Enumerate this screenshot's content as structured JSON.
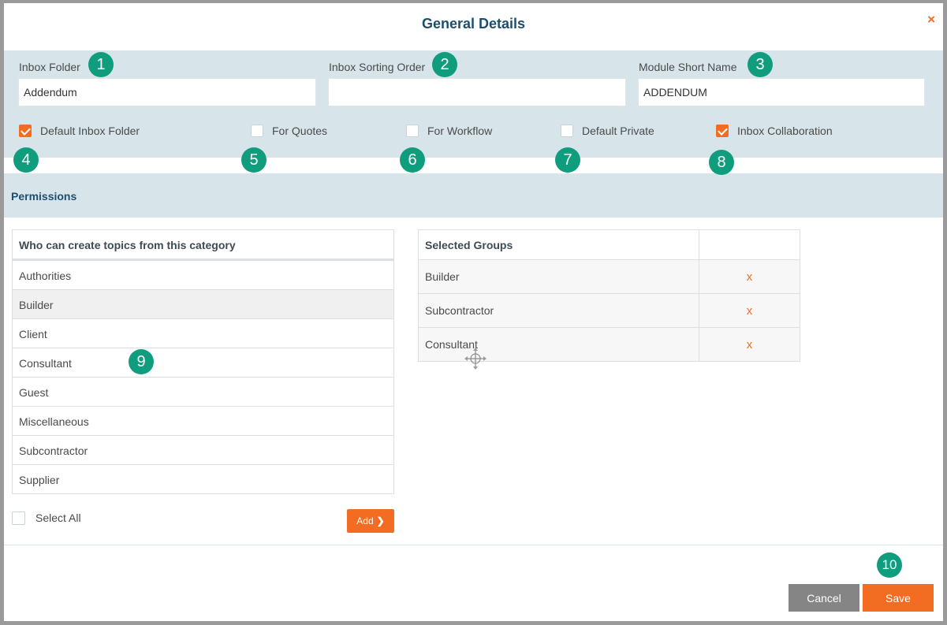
{
  "dialog": {
    "title": "General Details",
    "close_label": "×"
  },
  "fields": {
    "inbox_folder": {
      "label": "Inbox Folder",
      "value": "Addendum"
    },
    "inbox_sorting_order": {
      "label": "Inbox Sorting Order",
      "value": ""
    },
    "module_short_name": {
      "label": "Module Short Name",
      "value": "ADDENDUM"
    }
  },
  "checkboxes": {
    "default_inbox_folder": {
      "label": "Default Inbox Folder",
      "checked": true
    },
    "for_quotes": {
      "label": "For Quotes",
      "checked": false
    },
    "for_workflow": {
      "label": "For Workflow",
      "checked": false
    },
    "default_private": {
      "label": "Default Private",
      "checked": false
    },
    "inbox_collaboration": {
      "label": "Inbox Collaboration",
      "checked": true
    }
  },
  "permissions": {
    "title": "Permissions",
    "available_header": "Who can create topics from this category",
    "available": [
      "Authorities",
      "Builder",
      "Client",
      "Consultant",
      "Guest",
      "Miscellaneous",
      "Subcontractor",
      "Supplier"
    ],
    "selected_header": "Selected Groups",
    "selected": [
      "Builder",
      "Subcontractor",
      "Consultant"
    ],
    "remove_label": "x",
    "select_all_label": "Select All",
    "add_label": "Add",
    "add_chevron": "❯"
  },
  "footer": {
    "cancel_label": "Cancel",
    "save_label": "Save"
  },
  "annotations": [
    "1",
    "2",
    "3",
    "4",
    "5",
    "6",
    "7",
    "8",
    "9",
    "10"
  ],
  "colors": {
    "accent": "#f26c21",
    "heading": "#1d4e6e",
    "band": "#d7e5ea",
    "badge": "#0f9d7e",
    "cancel": "#858585"
  }
}
